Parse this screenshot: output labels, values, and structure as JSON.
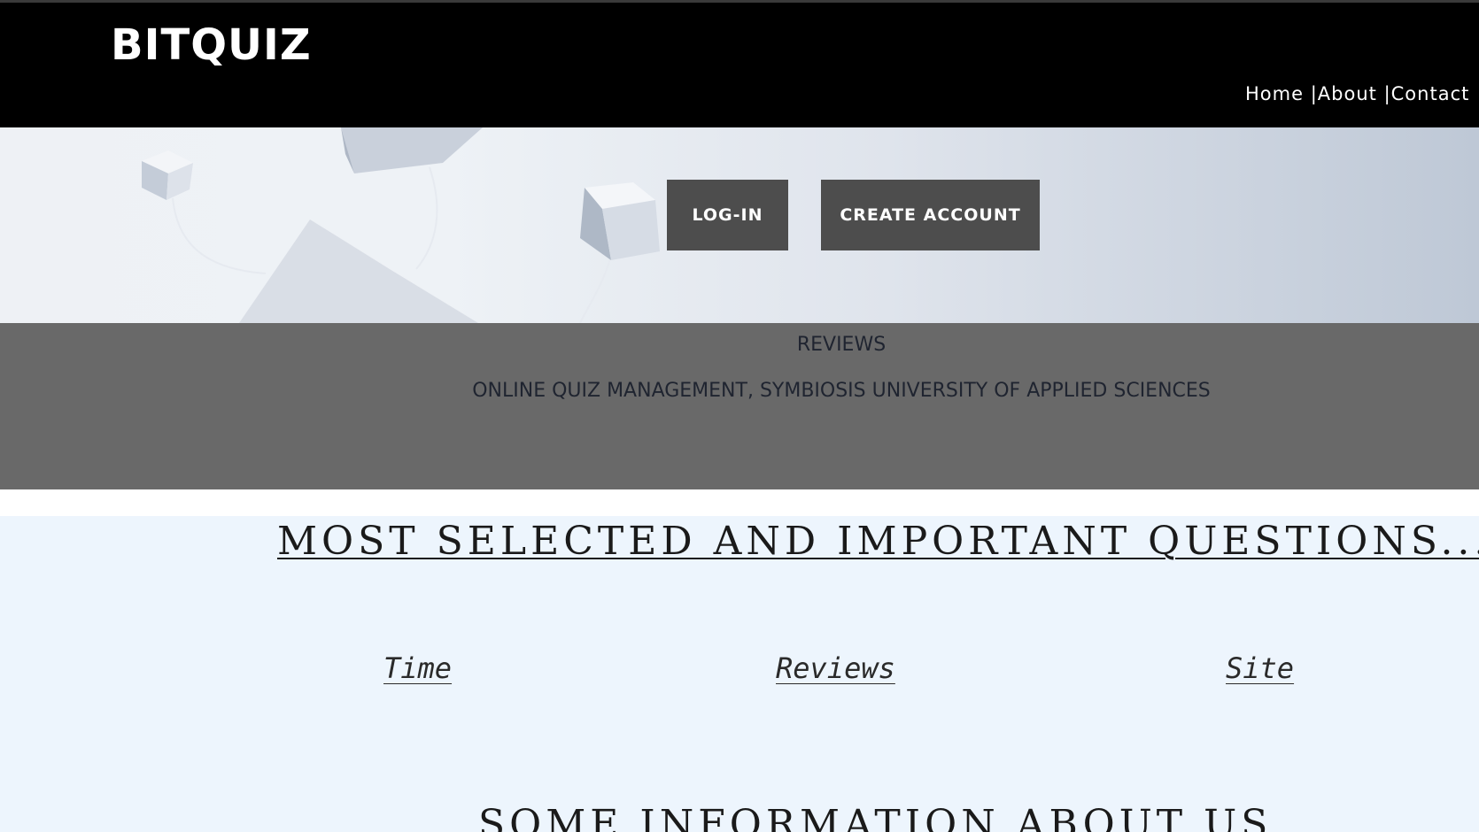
{
  "header": {
    "logo": "BITQUIZ",
    "nav": [
      {
        "label": "Home"
      },
      {
        "label": "About"
      },
      {
        "label": "Contact"
      }
    ],
    "separator": "|"
  },
  "hero": {
    "login_label": "LOG-IN",
    "create_label": "CREATE ACCOUNT"
  },
  "reviews": {
    "title": "REVIEWS",
    "subtitle": "ONLINE QUIZ MANAGEMENT, SYMBIOSIS UNIVERSITY OF APPLIED SCIENCES"
  },
  "main": {
    "heading": "MOST SELECTED AND IMPORTANT QUESTIONS....",
    "links": [
      {
        "label": "Time"
      },
      {
        "label": "Reviews"
      },
      {
        "label": "Site"
      }
    ],
    "info_heading": "SOME INFORMATION ABOUT US"
  },
  "colors": {
    "header_bg": "#000000",
    "button_bg": "#4d4d4d",
    "reviews_bg": "#696969",
    "main_bg": "#edf5fd"
  }
}
